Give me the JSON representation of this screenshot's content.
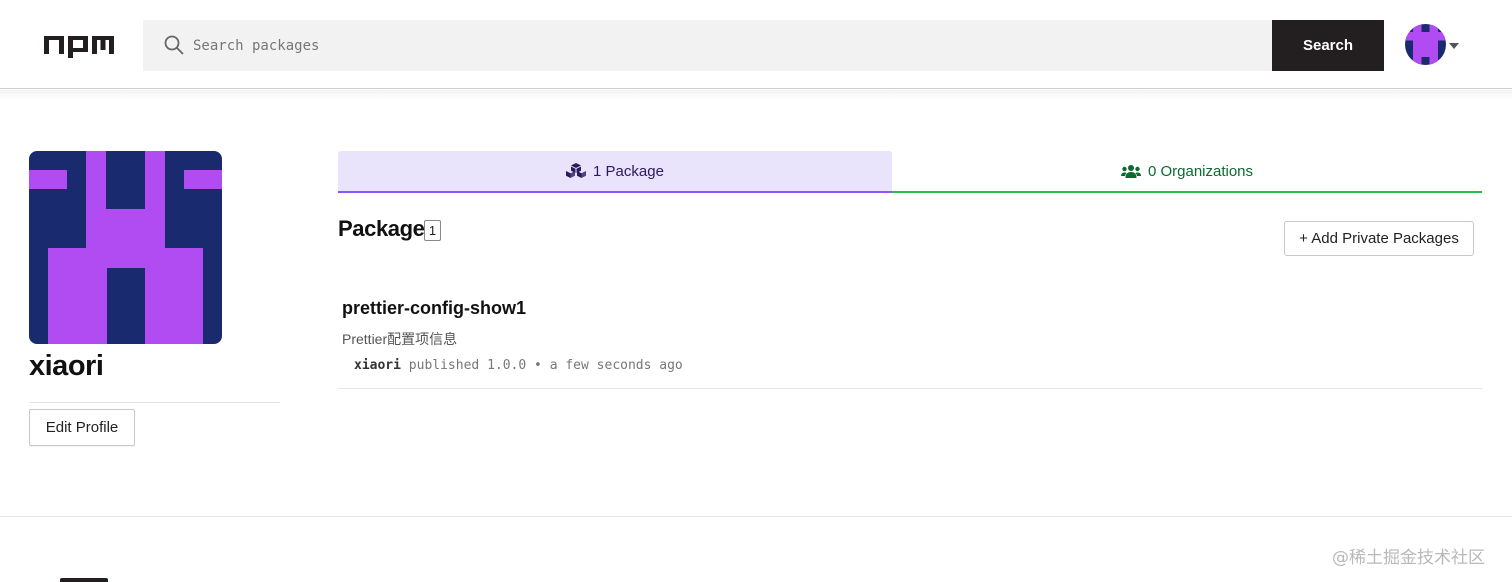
{
  "header": {
    "logo_text": "npm",
    "search": {
      "placeholder": "Search packages",
      "value": ""
    },
    "search_button_label": "Search"
  },
  "profile": {
    "username": "xiaori",
    "edit_button_label": "Edit Profile"
  },
  "tabs": [
    {
      "label": "1 Package",
      "icon": "cubes-icon",
      "active": true
    },
    {
      "label": "0 Organizations",
      "icon": "users-icon",
      "active": false
    }
  ],
  "packages_section": {
    "title": "Package",
    "count": "1",
    "add_button_label": "+ Add Private Packages",
    "items": [
      {
        "name": "prettier-config-show1",
        "description": "Prettier配置项信息",
        "publisher": "xiaori",
        "published_text": "published",
        "version": "1.0.0",
        "separator": "•",
        "time_ago": "a few seconds ago"
      }
    ]
  },
  "watermark": "@稀土掘金技术社区",
  "colors": {
    "accent_purple": "#8956ff",
    "tab_active_bg": "#e9e3fb",
    "org_green": "#29bd4e",
    "avatar_purple": "#b14cf2",
    "avatar_navy": "#1a2a6e",
    "search_button_bg": "#231f20"
  }
}
